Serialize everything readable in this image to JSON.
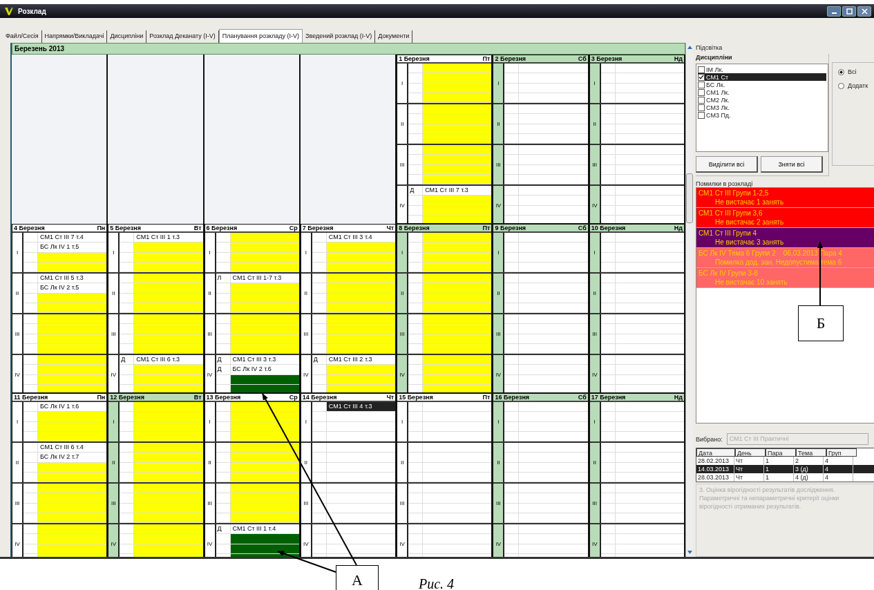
{
  "window": {
    "title": "Розклад"
  },
  "tabs": [
    {
      "label": "Файл/Сесія",
      "selected": false
    },
    {
      "label": "Напрямки/Викладачі",
      "selected": false
    },
    {
      "label": "Дисципліни",
      "selected": false
    },
    {
      "label": "Розклад Деканату (I-V)",
      "selected": false
    },
    {
      "label": "Планування розкладу (I-V)",
      "selected": true
    },
    {
      "label": "Зведений розклад (I-V)",
      "selected": false
    },
    {
      "label": "Документи",
      "selected": false
    }
  ],
  "month": "Березень  2013",
  "weeks": [
    {
      "days": [
        {
          "kind": "blank"
        },
        {
          "kind": "blank"
        },
        {
          "kind": "blank"
        },
        {
          "kind": "blank"
        },
        {
          "kind": "day",
          "date": "1 Березня",
          "weekday": "Пт",
          "shaded": false,
          "pairs": [
            {
              "label": "I",
              "color": "#ffff00"
            },
            {
              "label": "II",
              "color": "#ffff00"
            },
            {
              "label": "III",
              "color": "#ffff00"
            },
            {
              "label": "IV",
              "entries": [
                {
                  "mark": "Д",
                  "text": "СМ1 Ст III 7 т.3",
                  "selected": false
                }
              ],
              "color": "#ffff00"
            }
          ]
        },
        {
          "kind": "day",
          "date": "2 Березня",
          "weekday": "Сб",
          "shaded": true,
          "pairs": [
            {
              "label": "I"
            },
            {
              "label": "II"
            },
            {
              "label": "III"
            },
            {
              "label": "IV"
            }
          ]
        },
        {
          "kind": "day",
          "date": "3 Березня",
          "weekday": "Нд",
          "shaded": true,
          "pairs": [
            {
              "label": "I"
            },
            {
              "label": "II"
            },
            {
              "label": "III"
            },
            {
              "label": "IV"
            }
          ]
        }
      ]
    },
    {
      "days": [
        {
          "kind": "day",
          "date": "4 Березня",
          "weekday": "Пн",
          "shaded": false,
          "pairs": [
            {
              "label": "I",
              "entries": [
                {
                  "text": "СМ1 Ст III 7 т.4",
                  "selected": false
                },
                {
                  "text": "БС Лк IV 1 т.5",
                  "selected": false
                }
              ],
              "color": "#ffff00"
            },
            {
              "label": "II",
              "entries": [
                {
                  "text": "СМ1 Ст III 5 т.3",
                  "selected": false
                },
                {
                  "text": "БС Лк IV 2 т.5",
                  "selected": false
                }
              ],
              "color": "#ffff00"
            },
            {
              "label": "III",
              "color": "#ffff00"
            },
            {
              "label": "IV",
              "color": "#ffff00"
            }
          ]
        },
        {
          "kind": "day",
          "date": "5 Березня",
          "weekday": "Вт",
          "shaded": false,
          "pairs": [
            {
              "label": "I",
              "entries": [
                {
                  "text": "СМ1 Ст III 1 т.3",
                  "selected": false
                }
              ],
              "color": "#ffff00"
            },
            {
              "label": "II",
              "color": "#ffff00"
            },
            {
              "label": "III",
              "color": "#ffff00"
            },
            {
              "label": "IV",
              "entries": [
                {
                  "mark": "Д",
                  "text": "СМ1 Ст III 6 т.3",
                  "selected": false
                }
              ],
              "color": "#ffff00"
            }
          ]
        },
        {
          "kind": "day",
          "date": "6 Березня",
          "weekday": "Ср",
          "shaded": false,
          "pairs": [
            {
              "label": "I",
              "color": "#ffff00"
            },
            {
              "label": "II",
              "entries": [
                {
                  "mark": "Л",
                  "text": "СМ1 Ст III 1-7 т.3",
                  "selected": false
                }
              ],
              "color": "#ffff00"
            },
            {
              "label": "III",
              "color": "#ffff00"
            },
            {
              "label": "IV",
              "entries": [
                {
                  "mark": "Д",
                  "text": "СМ1 Ст III 3 т.3",
                  "selected": false
                },
                {
                  "mark": "Д",
                  "text": "БС Лк IV 2 т.6",
                  "selected": false
                }
              ],
              "color": "#006000"
            }
          ]
        },
        {
          "kind": "day",
          "date": "7 Березня",
          "weekday": "Чт",
          "shaded": false,
          "pairs": [
            {
              "label": "I",
              "entries": [
                {
                  "text": "СМ1 Ст III 3 т.4",
                  "selected": false
                }
              ],
              "color": "#ffff00"
            },
            {
              "label": "II",
              "color": "#ffff00"
            },
            {
              "label": "III",
              "color": "#ffff00"
            },
            {
              "label": "IV",
              "entries": [
                {
                  "mark": "Д",
                  "text": "СМ1 Ст III 2 т.3",
                  "selected": false
                }
              ],
              "color": "#ffff00"
            }
          ]
        },
        {
          "kind": "day",
          "date": "8 Березня",
          "weekday": "Пт",
          "shaded": true,
          "pairs": [
            {
              "label": "I",
              "color": "#ffff00"
            },
            {
              "label": "II",
              "color": "#ffff00"
            },
            {
              "label": "III",
              "color": "#ffff00"
            },
            {
              "label": "IV",
              "color": "#ffff00"
            }
          ]
        },
        {
          "kind": "day",
          "date": "9 Березня",
          "weekday": "Сб",
          "shaded": true,
          "pairs": [
            {
              "label": "I"
            },
            {
              "label": "II"
            },
            {
              "label": "III"
            },
            {
              "label": "IV"
            }
          ]
        },
        {
          "kind": "day",
          "date": "10 Березня",
          "weekday": "Нд",
          "shaded": true,
          "pairs": [
            {
              "label": "I"
            },
            {
              "label": "II"
            },
            {
              "label": "III"
            },
            {
              "label": "IV"
            }
          ]
        }
      ]
    },
    {
      "days": [
        {
          "kind": "day",
          "date": "11 Березня",
          "weekday": "Пн",
          "shaded": false,
          "pairs": [
            {
              "label": "I",
              "entries": [
                {
                  "text": "БС Лк IV 1 т.6",
                  "selected": false
                }
              ],
              "color": "#ffff00"
            },
            {
              "label": "II",
              "entries": [
                {
                  "text": "СМ1 Ст III 6 т.4",
                  "selected": false
                },
                {
                  "text": "БС Лк IV 2 т.7",
                  "selected": false
                }
              ],
              "color": "#ffff00"
            },
            {
              "label": "III",
              "color": "#ffff00"
            },
            {
              "label": "IV",
              "color": "#ffff00"
            }
          ]
        },
        {
          "kind": "day",
          "date": "12 Березня",
          "weekday": "Вт",
          "shaded": true,
          "pairs": [
            {
              "label": "I",
              "color": "#ffff00"
            },
            {
              "label": "II",
              "color": "#ffff00"
            },
            {
              "label": "III",
              "color": "#ffff00"
            },
            {
              "label": "IV",
              "color": "#ffff00"
            }
          ]
        },
        {
          "kind": "day",
          "date": "13 Березня",
          "weekday": "Ср",
          "shaded": false,
          "pairs": [
            {
              "label": "I",
              "color": "#ffff00"
            },
            {
              "label": "II",
              "color": "#ffff00"
            },
            {
              "label": "III",
              "color": "#ffff00"
            },
            {
              "label": "IV",
              "entries": [
                {
                  "mark": "Д",
                  "text": "СМ1 Ст III 1 т.4",
                  "selected": false
                }
              ],
              "color": "#006000"
            }
          ]
        },
        {
          "kind": "day",
          "date": "14 Березня",
          "weekday": "Чт",
          "shaded": false,
          "pairs": [
            {
              "label": "I",
              "entries": [
                {
                  "text": "СМ1 Ст III 4 т.3",
                  "selected": true
                }
              ]
            },
            {
              "label": "II"
            },
            {
              "label": "III"
            },
            {
              "label": "IV"
            }
          ]
        },
        {
          "kind": "day",
          "date": "15 Березня",
          "weekday": "Пт",
          "shaded": false,
          "pairs": [
            {
              "label": "I"
            },
            {
              "label": "II"
            },
            {
              "label": "III"
            },
            {
              "label": "IV"
            }
          ]
        },
        {
          "kind": "day",
          "date": "16 Березня",
          "weekday": "Сб",
          "shaded": true,
          "pairs": [
            {
              "label": "I"
            },
            {
              "label": "II"
            },
            {
              "label": "III"
            },
            {
              "label": "IV"
            }
          ]
        },
        {
          "kind": "day",
          "date": "17 Березня",
          "weekday": "Нд",
          "shaded": true,
          "pairs": [
            {
              "label": "I"
            },
            {
              "label": "II"
            },
            {
              "label": "III"
            },
            {
              "label": "IV"
            }
          ]
        }
      ]
    }
  ],
  "panel": {
    "title": "Підсвітка",
    "disciplines": {
      "title": "Дисципліни",
      "items": [
        {
          "label": "ІМ Лк.",
          "checked": false,
          "selected": false
        },
        {
          "label": "СМ1 Ст",
          "checked": true,
          "selected": true
        },
        {
          "label": "БС Лк.",
          "checked": false,
          "selected": false
        },
        {
          "label": "СМ1 Лк.",
          "checked": false,
          "selected": false
        },
        {
          "label": "СМ2 Лк.",
          "checked": false,
          "selected": false
        },
        {
          "label": "СМ3 Лк.",
          "checked": false,
          "selected": false
        },
        {
          "label": "СМ3 Пд.",
          "checked": false,
          "selected": false
        }
      ],
      "buttons": [
        "Виділити всі",
        "Зняти всі"
      ]
    },
    "radios": [
      {
        "label": "Всі",
        "selected": true
      },
      {
        "label": "Додатк",
        "selected": false
      }
    ],
    "errors_title": "Помилки в розкладі",
    "errors": [
      {
        "title": "СМ1 Ст III Групи 1-2,5",
        "detail": "Не вистачає 1 занять",
        "color": "#ff0000"
      },
      {
        "title": "СМ1 Ст III Групи 3,6",
        "detail": "Не вистачає 2 занять",
        "color": "#ff0000"
      },
      {
        "title": "СМ1 Ст III Групи 4",
        "detail": "Не вистачає 3 занять",
        "color": "#660066"
      },
      {
        "title": "БС Лк IV Тема 6 Групи 2    06.03.2013 Пара 4",
        "detail": "Помилка дод. зан. Недопустима тема 6",
        "color": "#ff6666"
      },
      {
        "title": "БС Лк IV Групи 3-8",
        "detail": "Не вистачає 10 занять",
        "color": "#ff6666"
      }
    ],
    "chosen_label": "Вибрано:",
    "chosen_value": "СМ1 Ст III   Практичні",
    "table": {
      "columns": [
        "Дата",
        "День",
        "Пара",
        "Тема",
        "Груп"
      ],
      "rows": [
        {
          "cells": [
            "28.02.2013",
            "Чт",
            "1",
            "2",
            "4"
          ],
          "selected": false
        },
        {
          "cells": [
            "14.03.2013",
            "Чт",
            "1",
            "3 (д)",
            "4"
          ],
          "selected": true
        },
        {
          "cells": [
            "28.03.2013",
            "Чт",
            "1",
            "4 (д)",
            "4"
          ],
          "selected": false
        }
      ]
    },
    "description": "3. Оцінка вірогідності результатів дослідження. Параметричні та непараметричні критерії оцінки вірогідності отриманих результатів."
  },
  "annotations": [
    "А",
    "Б"
  ],
  "caption": "Рис. 4"
}
